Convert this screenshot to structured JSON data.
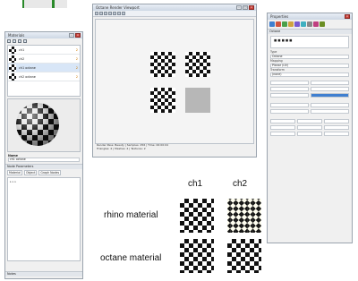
{
  "left_panel": {
    "title": "Materials",
    "materials": [
      {
        "name": "ch1",
        "mark": "2"
      },
      {
        "name": "ch2",
        "mark": "2"
      },
      {
        "name": "ch1 octane",
        "mark": "2"
      },
      {
        "name": "ch2 octane",
        "mark": "2"
      }
    ],
    "name_label": "Name",
    "name_value": "ch1 octane",
    "tabs": [
      "Material",
      "Object",
      "Graph Nodes"
    ],
    "sections": [
      "Node Parameters",
      "Notes"
    ]
  },
  "center_window": {
    "title": "Octane Render Viewport",
    "status_lines": [
      "Render Pass: Beauty | Samples: 256 | Time: 00:00:04",
      "Triangles: 4 | Meshes: 4 | Textures: 2"
    ]
  },
  "right_panel": {
    "title": "Properties",
    "section": "Octane",
    "rows": [
      {
        "label": "Type",
        "value": "Octane"
      },
      {
        "label": "Mapping",
        "value": "Planar (UV)"
      },
      {
        "label": "Transform",
        "value": "(none)"
      }
    ]
  },
  "comparison": {
    "columns": [
      "ch1",
      "ch2"
    ],
    "rows": [
      "rhino material",
      "octane material"
    ]
  }
}
